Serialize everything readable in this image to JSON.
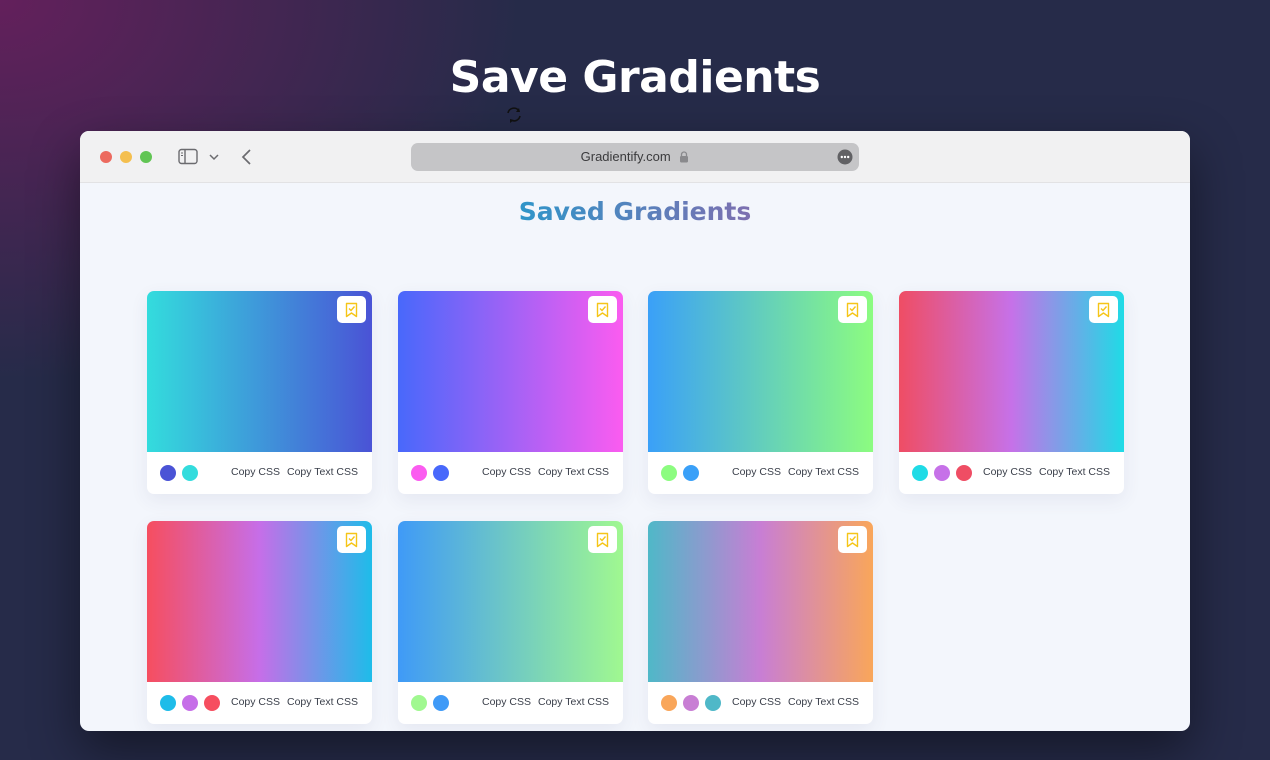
{
  "hero": {
    "title": "Save Gradients"
  },
  "browser": {
    "url": "Gradientify.com"
  },
  "page": {
    "heading": "Saved Gradients"
  },
  "labels": {
    "copy_css": "Copy CSS",
    "copy_text_css": "Copy Text CSS"
  },
  "colors": {
    "bookmark_accent": "#f5c518",
    "heading_gradient": [
      "#2f95c9",
      "#7d6fb0"
    ]
  },
  "gradients": [
    {
      "direction": "to right",
      "stops": [
        "#33dcdd",
        "#4a53d6"
      ],
      "swatches": [
        "#4a53d6",
        "#33dcdd"
      ]
    },
    {
      "direction": "to right",
      "stops": [
        "#4868fb",
        "#fb5cf0"
      ],
      "swatches": [
        "#fb5cf0",
        "#4868fb"
      ]
    },
    {
      "direction": "to right",
      "stops": [
        "#3aa0f8",
        "#8cfc80"
      ],
      "swatches": [
        "#8cfc80",
        "#3aa0f8"
      ]
    },
    {
      "direction": "to right",
      "stops": [
        "#ef4d64",
        "#c671e8",
        "#1fdbe6"
      ],
      "swatches": [
        "#1fdbe6",
        "#c671e8",
        "#ef4d64"
      ]
    },
    {
      "direction": "to right",
      "stops": [
        "#f64e5f",
        "#c66ee8",
        "#1ebce9"
      ],
      "swatches": [
        "#1ebce9",
        "#c66ee8",
        "#f64e5f"
      ]
    },
    {
      "direction": "to right",
      "stops": [
        "#3f9af7",
        "#a0f890"
      ],
      "swatches": [
        "#a0f890",
        "#3f9af7"
      ]
    },
    {
      "direction": "to right",
      "stops": [
        "#4fb8c8",
        "#c87ed4",
        "#f9a65a"
      ],
      "swatches": [
        "#f9a65a",
        "#c87ed4",
        "#4fb8c8"
      ]
    }
  ]
}
